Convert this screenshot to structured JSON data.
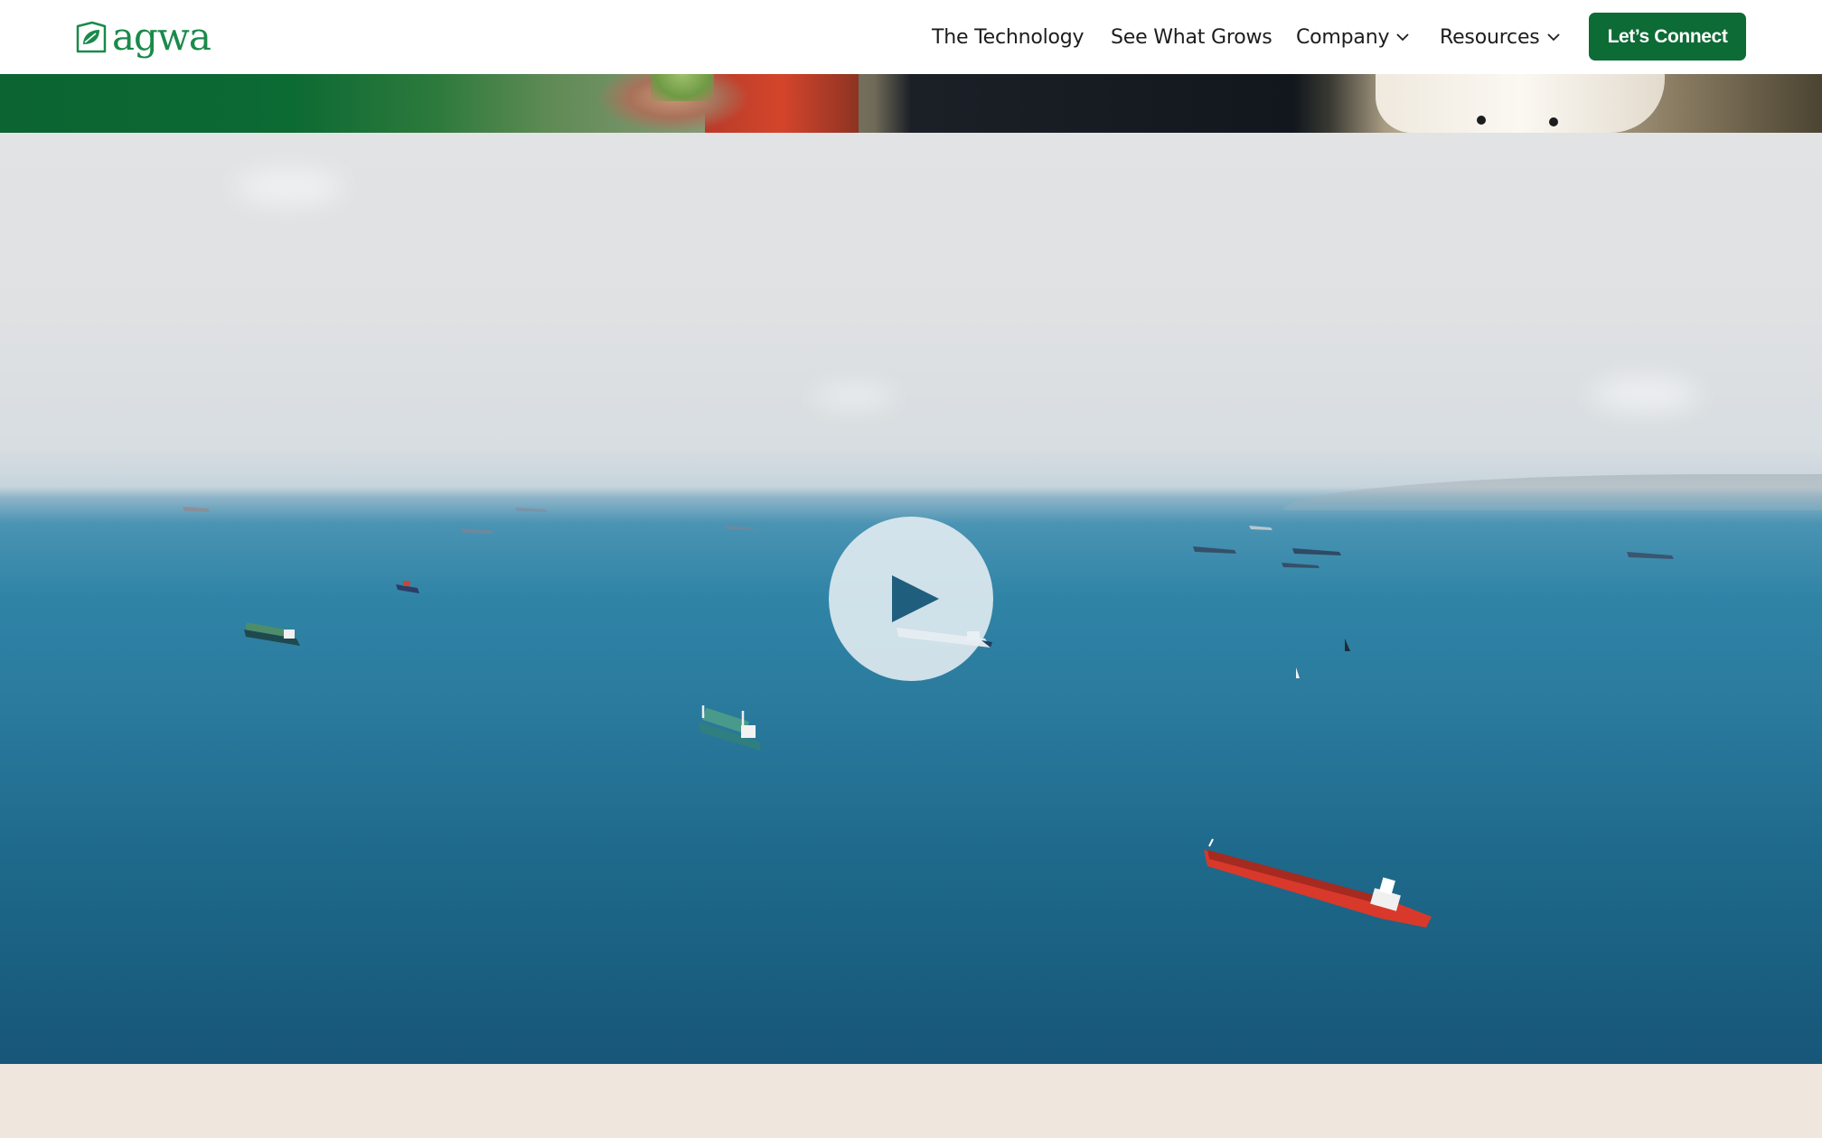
{
  "brand": {
    "name": "agwa",
    "color": "#1a8a4a"
  },
  "nav": {
    "items": [
      {
        "label": "The Technology",
        "dropdown": false
      },
      {
        "label": "See What Grows",
        "dropdown": false
      },
      {
        "label": "Company",
        "dropdown": true
      },
      {
        "label": "Resources",
        "dropdown": true
      }
    ],
    "cta_label": "Let’s Connect",
    "cta_color": "#0d6b35"
  },
  "video": {
    "play_icon": "play-icon"
  },
  "colors": {
    "section_bg": "#efe6dd",
    "header_bg": "#ffffff"
  }
}
